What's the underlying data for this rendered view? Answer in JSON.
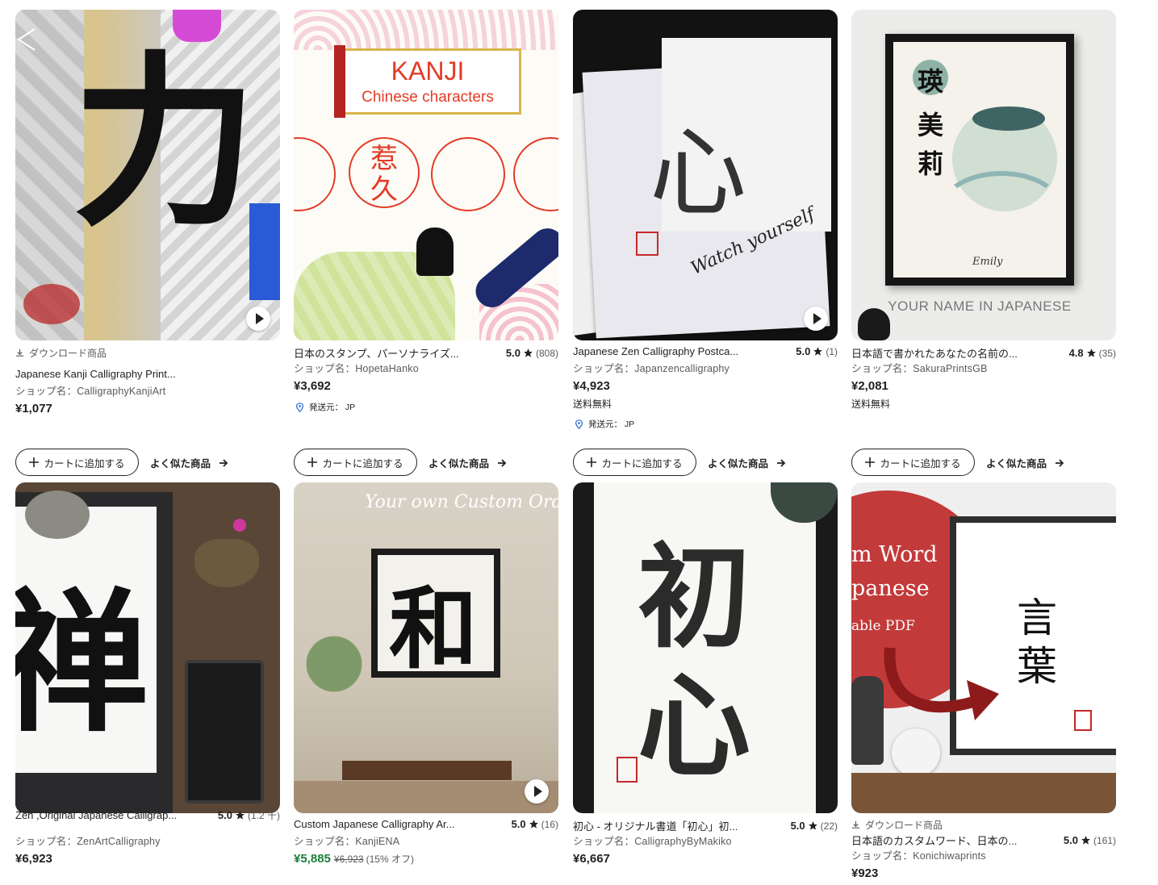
{
  "listings": [
    {
      "download_label": "ダウンロード商品",
      "title": "Japanese Kanji Calligraphy Print...",
      "shop": "ショップ名：CalligraphyKanjiArt",
      "price": "¥1,077",
      "cart_label": "カートに追加する",
      "similar_label": "よく似た商品",
      "image": {
        "kanji": "力"
      }
    },
    {
      "title": "日本のスタンプ、パーソナライズ...",
      "rating": "5.0",
      "reviews": "(808)",
      "shop": "ショップ名：HopetaHanko",
      "price": "¥3,692",
      "ships_from": "発送元： JP",
      "cart_label": "カートに追加する",
      "similar_label": "よく似た商品",
      "image": {
        "line1": "KANJI",
        "line2": "Chinese characters",
        "stamp1": "惹",
        "stamp2": "久"
      }
    },
    {
      "title": "Japanese Zen Calligraphy Postca...",
      "rating": "5.0",
      "reviews": "(1)",
      "shop": "ショップ名：Japanzencalligraphy",
      "price": "¥4,923",
      "free_shipping": "送料無料",
      "ships_from": "発送元： JP",
      "cart_label": "カートに追加する",
      "similar_label": "よく似た商品",
      "image": {
        "kanji": "心",
        "script": "Watch yourself"
      }
    },
    {
      "title": "日本語で書かれたあなたの名前の...",
      "rating": "4.8",
      "reviews": "(35)",
      "shop": "ショップ名：SakuraPrintsGB",
      "price": "¥2,081",
      "free_shipping": "送料無料",
      "cart_label": "カートに追加する",
      "similar_label": "よく似た商品",
      "image": {
        "k1": "瑛",
        "k2": "美",
        "k3": "莉",
        "name": "Emily",
        "caption": "YOUR NAME IN JAPANESE"
      }
    },
    {
      "title": "Zen ,Original Japanese Calligrap...",
      "rating": "5.0",
      "reviews": "(1.2 千)",
      "shop": "ショップ名：ZenArtCalligraphy",
      "price": "¥6,923",
      "image": {
        "kanji": "禅"
      }
    },
    {
      "title": "Custom Japanese Calligraphy Ar...",
      "rating": "5.0",
      "reviews": "(16)",
      "shop": "ショップ名：KanjiENA",
      "price": "¥5,885",
      "original_price": "¥6,923",
      "discount": "(15% オフ)",
      "image": {
        "kanji": "和",
        "script": "Your own Custom Order"
      }
    },
    {
      "title": "初心 - オリジナル書道「初心」初...",
      "rating": "5.0",
      "reviews": "(22)",
      "shop": "ショップ名：CalligraphyByMakiko",
      "price": "¥6,667",
      "image": {
        "k1": "初",
        "k2": "心"
      }
    },
    {
      "download_label": "ダウンロード商品",
      "title": "日本語のカスタムワード、日本の...",
      "rating": "5.0",
      "reviews": "(161)",
      "shop": "ショップ名：Konichiwaprints",
      "price": "¥923",
      "image": {
        "line1": "m Word",
        "line2": "panese",
        "line3": "able PDF",
        "k1": "言",
        "k2": "葉"
      }
    }
  ]
}
